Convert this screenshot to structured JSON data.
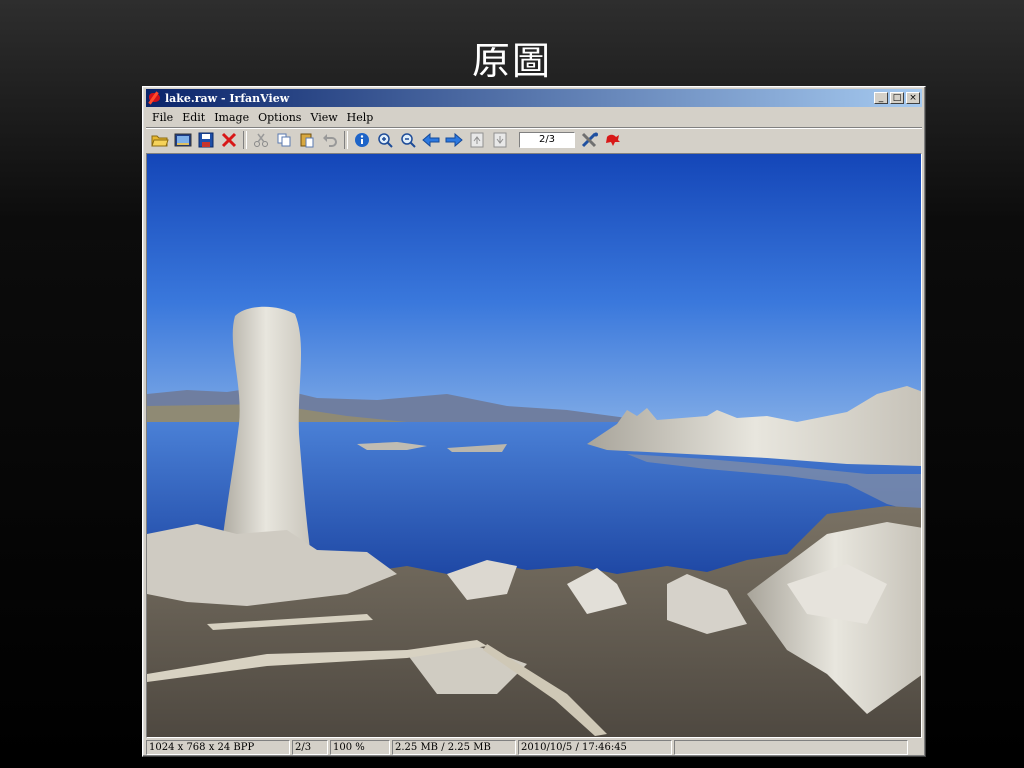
{
  "slide": {
    "title": "原圖"
  },
  "window": {
    "title": "lake.raw - IrfanView",
    "controls": {
      "minimize": "_",
      "maximize": "□",
      "close": "×"
    }
  },
  "menu": {
    "items": [
      {
        "label": "File"
      },
      {
        "label": "Edit"
      },
      {
        "label": "Image"
      },
      {
        "label": "Options"
      },
      {
        "label": "View"
      },
      {
        "label": "Help"
      }
    ]
  },
  "toolbar": {
    "icons": [
      "open-icon",
      "slideshow-icon",
      "save-icon",
      "delete-icon",
      "cut-icon",
      "copy-icon",
      "paste-icon",
      "undo-icon",
      "info-icon",
      "zoom-in-icon",
      "zoom-out-icon",
      "previous-icon",
      "next-icon",
      "first-page-icon",
      "last-page-icon",
      "settings-icon",
      "exit-icon"
    ],
    "page_value": "2/3"
  },
  "image": {
    "description_icon": "photo-icon"
  },
  "status": {
    "dimensions": "1024 x 768 x 24 BPP",
    "page": "2/3",
    "zoom": "100 %",
    "size": "2.25 MB / 2.25 MB",
    "datetime": "2010/10/5 / 17:46:45",
    "extra": ""
  },
  "colors": {
    "titlebar_start": "#0a246a",
    "titlebar_end": "#a6caf0",
    "window_bg": "#d4d0c8",
    "sky": "#1e56c8",
    "lake": "#2a5cc0"
  }
}
